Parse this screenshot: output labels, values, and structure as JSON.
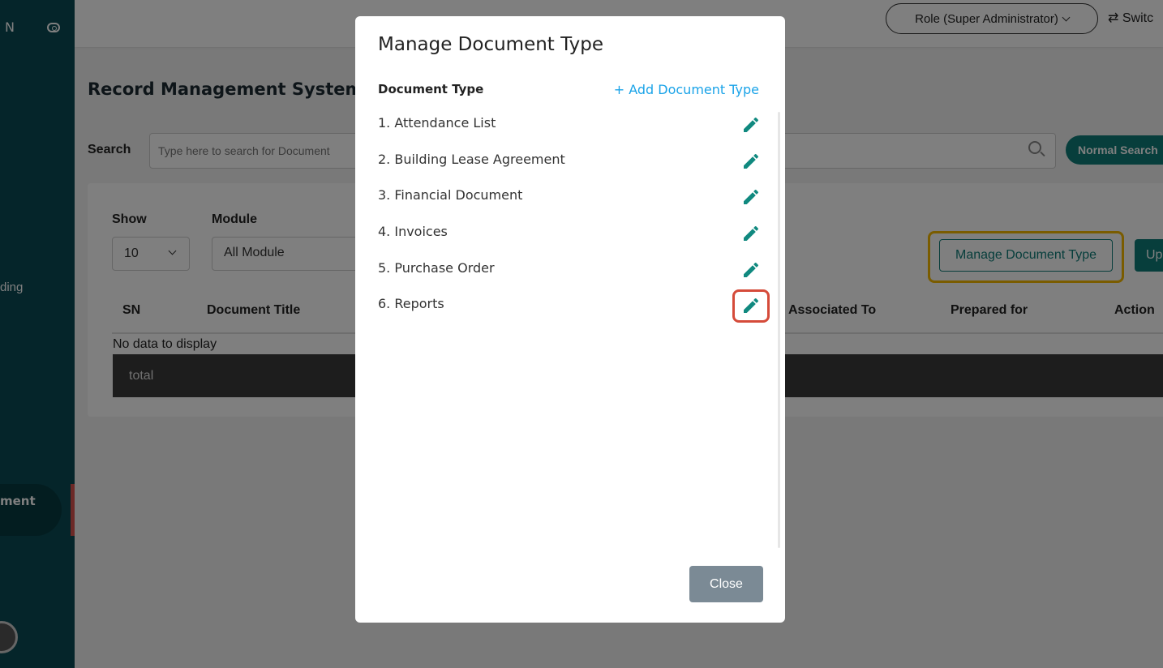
{
  "sidebar": {
    "brand": "N",
    "items": [
      {
        "label": "ding"
      },
      {
        "label": "ment"
      }
    ]
  },
  "topbar": {
    "role": "Role (Super Administrator)",
    "switch": "⇄ Switc"
  },
  "page": {
    "title": "Record Management System",
    "search_label": "Search",
    "search_placeholder": "Type here to search for Document",
    "normal_search": "Normal Search",
    "filters": {
      "show_label": "Show",
      "show_value": "10",
      "module_label": "Module",
      "module_value": "All Module"
    },
    "manage_button": "Manage Document Type",
    "upload_button": "Up",
    "table": {
      "headers": [
        "SN",
        "Document Title",
        "Associated To",
        "Prepared for",
        "Action"
      ],
      "empty": "No data to display",
      "total": "total"
    }
  },
  "modal": {
    "title": "Manage Document Type",
    "column_header": "Document Type",
    "add_link": "+ Add Document Type",
    "items": [
      {
        "label": "1. Attendance List"
      },
      {
        "label": "2. Building Lease Agreement"
      },
      {
        "label": "3. Financial Document"
      },
      {
        "label": "4. Invoices"
      },
      {
        "label": "5. Purchase Order"
      },
      {
        "label": "6. Reports"
      }
    ],
    "close": "Close"
  },
  "colors": {
    "teal": "#0e7d78",
    "edit_icon": "#10897f",
    "link": "#1aa3e8",
    "highlight_yellow": "#f5b800",
    "highlight_red": "#d54b3a"
  }
}
